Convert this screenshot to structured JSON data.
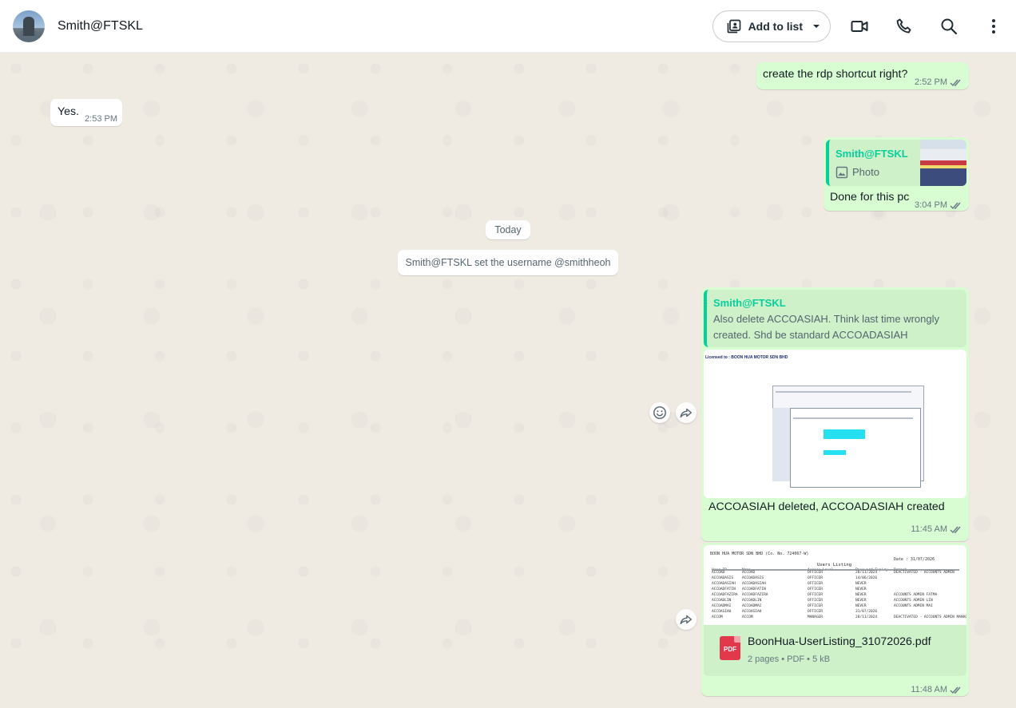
{
  "header": {
    "contact_name": "Smith@FTSKL",
    "add_to_list_label": "Add to list",
    "icons": [
      "video-call-icon",
      "voice-call-icon",
      "search-icon",
      "menu-icon"
    ]
  },
  "colors": {
    "outgoing_bubble": "#d9fdd3",
    "incoming_bubble": "#ffffff",
    "quote_accent": "#06cf9c",
    "chat_background": "#efeae2"
  },
  "messages": {
    "m1": {
      "text": "create the rdp shortcut right?",
      "time": "2:52 PM"
    },
    "m2": {
      "text": "Yes.",
      "time": "2:53 PM"
    },
    "m3": {
      "quote_author": "Smith@FTSKL",
      "quote_label": "Photo",
      "text": "Done for this pc",
      "time": "3:04 PM"
    },
    "m4": {
      "quote_author": "Smith@FTSKL",
      "quote_text": "Also delete ACCOASIAH. Think last time wrongly created. Shd be standard ACCOADASIAH",
      "image_caption_line": "Licensed to : BOON HUA MOTOR SDN BHD",
      "text": "ACCOASIAH deleted, ACCOADASIAH created",
      "time": "11:45 AM"
    },
    "m5": {
      "file_name": "BoonHua-UserListing_31072026.pdf",
      "file_meta": "2 pages • PDF • 5 kB",
      "file_badge": "PDF",
      "time": "11:48 AM"
    }
  },
  "system": {
    "date_divider": "Today",
    "notice": "Smith@FTSKL set the username @smithheoh"
  },
  "doc_preview": {
    "company": "BOON HUA MOTOR SDN BHD (Co. No. 724067-W)",
    "date": "Date : 31/07/2026",
    "heading": "Users Listing",
    "columns": [
      "User ID",
      "Name",
      "Access Level",
      "Password Expiry",
      "Remark"
    ],
    "rows": [
      [
        "ACCOAD",
        "ACCOAD",
        "OFFICER",
        "28/11/2024",
        "DEACTIVATED - ACCOUNTS ADMIN"
      ],
      [
        "ACCOADASIS",
        "ACCOADASIS",
        "OFFICER",
        "14/06/2026",
        ""
      ],
      [
        "ACCOADASIAH",
        "ACCOADASIAH",
        "OFFICER",
        "NEVER",
        ""
      ],
      [
        "ACCOADFATIN",
        "ACCOADFATIN",
        "OFFICER",
        "NEVER",
        ""
      ],
      [
        "ACCOADFAZIRA",
        "ACCOADFAZIRA",
        "OFFICER",
        "NEVER",
        "ACCOUNTS ADMIN FATMA"
      ],
      [
        "ACCOADLIN",
        "ACCOADLIN",
        "OFFICER",
        "NEVER",
        "ACCOUNTS ADMIN LIN"
      ],
      [
        "ACCOADMAI",
        "ACCOADMAI",
        "OFFICER",
        "NEVER",
        "ACCOUNTS ADMIN MAI"
      ],
      [
        "ACCOASIAH",
        "ACCOASIAH",
        "OFFICER",
        "31/07/2026",
        ""
      ],
      [
        "ACCOM",
        "ACCOM",
        "MANAGER",
        "28/11/2024",
        "DEACTIVATED - ACCOUNTS ADMIN MANAGER"
      ]
    ]
  }
}
